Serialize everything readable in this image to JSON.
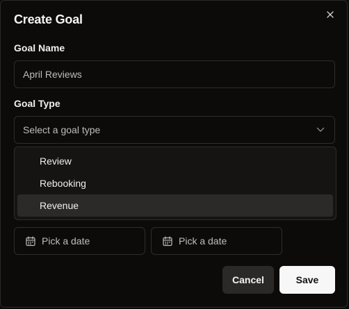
{
  "dialog": {
    "title": "Create Goal",
    "close_icon": "close-icon"
  },
  "goal_name": {
    "label": "Goal Name",
    "value": "April Reviews"
  },
  "goal_type": {
    "label": "Goal Type",
    "placeholder": "Select a goal type",
    "chevron_icon": "chevron-down-icon",
    "options": [
      {
        "label": "Review",
        "highlighted": false
      },
      {
        "label": "Rebooking",
        "highlighted": false
      },
      {
        "label": "Revenue",
        "highlighted": true
      }
    ]
  },
  "dates": {
    "start_placeholder": "Pick a date",
    "end_placeholder": "Pick a date",
    "icon": "calendar-icon"
  },
  "actions": {
    "cancel_label": "Cancel",
    "save_label": "Save"
  },
  "colors": {
    "background": "#0c0b0a",
    "border": "#2e2d2c",
    "highlight": "#2c2a28",
    "save_bg": "#f7f7f7",
    "cancel_bg": "#2a2928"
  }
}
